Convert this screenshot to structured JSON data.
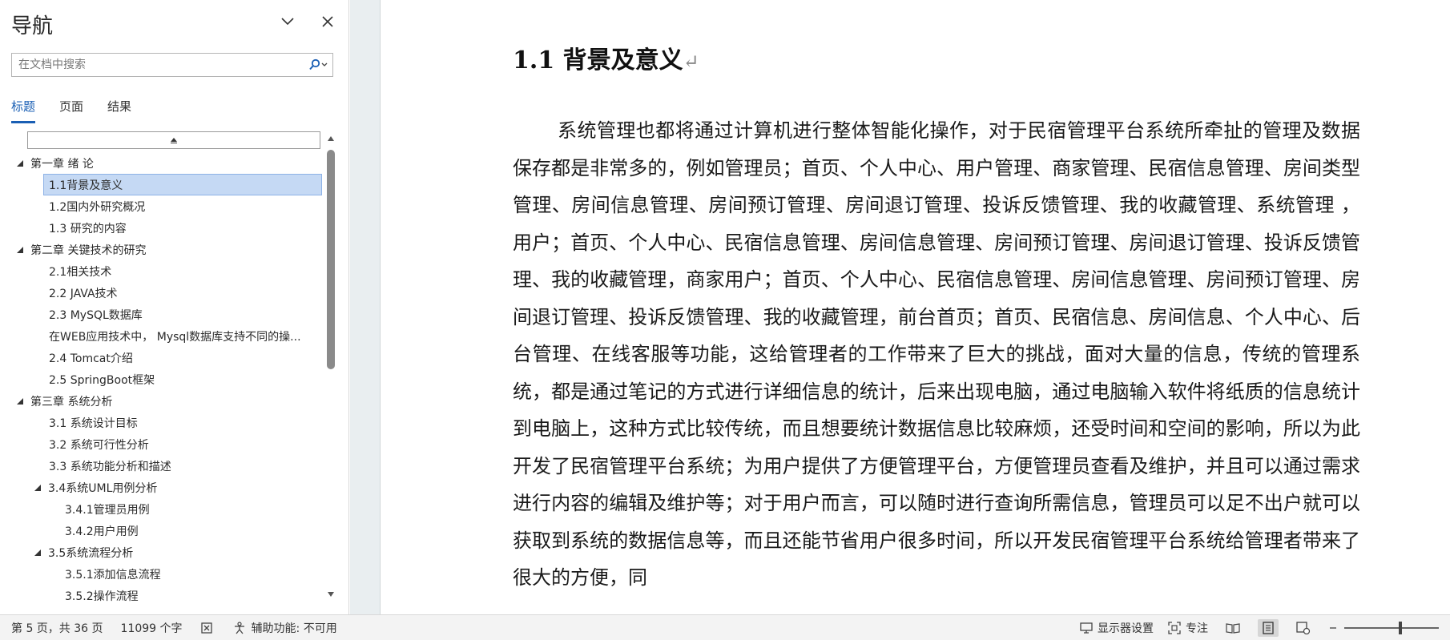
{
  "nav": {
    "title": "导航",
    "search_placeholder": "在文档中搜索",
    "tabs": [
      {
        "label": "标题",
        "active": true
      },
      {
        "label": "页面",
        "active": false
      },
      {
        "label": "结果",
        "active": false
      }
    ],
    "headings": [
      {
        "label": "第一章 绪 论",
        "level": 1,
        "expanded": true
      },
      {
        "label": "1.1背景及意义",
        "level": 2,
        "selected": true
      },
      {
        "label": "1.2国内外研究概况",
        "level": 2
      },
      {
        "label": "1.3 研究的内容",
        "level": 2
      },
      {
        "label": "第二章 关键技术的研究",
        "level": 1,
        "expanded": true
      },
      {
        "label": "2.1相关技术",
        "level": 2
      },
      {
        "label": "2.2 JAVA技术",
        "level": 2
      },
      {
        "label": "2.3 MySQL数据库",
        "level": 2
      },
      {
        "label": "在WEB应用技术中， Mysql数据库支持不同的操...",
        "level": 2
      },
      {
        "label": "2.4 Tomcat介绍",
        "level": 2
      },
      {
        "label": "2.5 SpringBoot框架",
        "level": 2
      },
      {
        "label": "第三章 系统分析",
        "level": 1,
        "expanded": true
      },
      {
        "label": "3.1 系统设计目标",
        "level": 2
      },
      {
        "label": "3.2 系统可行性分析",
        "level": 2
      },
      {
        "label": "3.3 系统功能分析和描述",
        "level": 2
      },
      {
        "label": "3.4系统UML用例分析",
        "level": 2,
        "expanded": true
      },
      {
        "label": "3.4.1管理员用例",
        "level": 3
      },
      {
        "label": "3.4.2用户用例",
        "level": 3
      },
      {
        "label": "3.5系统流程分析",
        "level": 2,
        "expanded": true
      },
      {
        "label": "3.5.1添加信息流程",
        "level": 3
      },
      {
        "label": "3.5.2操作流程",
        "level": 3
      }
    ]
  },
  "document": {
    "heading": "1.1 背景及意义",
    "paragraph": "系统管理也都将通过计算机进行整体智能化操作，对于民宿管理平台系统所牵扯的管理及数据保存都是非常多的，例如管理员；首页、个人中心、用户管理、商家管理、民宿信息管理、房间类型管理、房间信息管理、房间预订管理、房间退订管理、投诉反馈管理、我的收藏管理、系统管理 ，用户；首页、个人中心、民宿信息管理、房间信息管理、房间预订管理、房间退订管理、投诉反馈管理、我的收藏管理，商家用户；首页、个人中心、民宿信息管理、房间信息管理、房间预订管理、房间退订管理、投诉反馈管理、我的收藏管理，前台首页；首页、民宿信息、房间信息、个人中心、后台管理、在线客服等功能，这给管理者的工作带来了巨大的挑战，面对大量的信息，传统的管理系统，都是通过笔记的方式进行详细信息的统计，后来出现电脑，通过电脑输入软件将纸质的信息统计到电脑上，这种方式比较传统，而且想要统计数据信息比较麻烦，还受时间和空间的影响，所以为此开发了民宿管理平台系统；为用户提供了方便管理平台，方便管理员查看及维护，并且可以通过需求进行内容的编辑及维护等；对于用户而言，可以随时进行查询所需信息，管理员可以足不出户就可以获取到系统的数据信息等，而且还能节省用户很多时间，所以开发民宿管理平台系统给管理者带来了很大的方便，同"
  },
  "status": {
    "page": "第 5 页，共 36 页",
    "words": "11099 个字",
    "accessibility": "辅助功能: 不可用",
    "display_settings": "显示器设置",
    "focus": "专注"
  },
  "colors": {
    "accent": "#1a5fb4",
    "selected_bg": "#c5d9f4",
    "gutter": "#e9eef0"
  }
}
